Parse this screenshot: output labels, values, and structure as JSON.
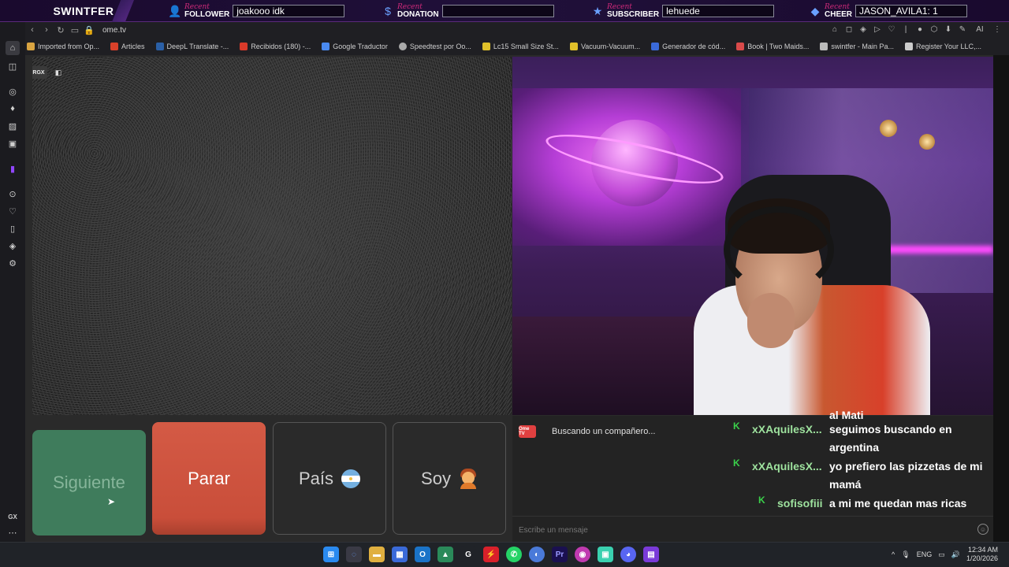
{
  "overlay": {
    "brand": "SWINTFER",
    "segments": [
      {
        "recent": "Recent",
        "kind": "FOLLOWER",
        "value": "joakooo idk",
        "icon": "user-icon"
      },
      {
        "recent": "Recent",
        "kind": "DONATION",
        "value": "",
        "icon": "dollar-icon"
      },
      {
        "recent": "Recent",
        "kind": "SUBSCRIBER",
        "value": "lehuede",
        "icon": "star-icon"
      },
      {
        "recent": "Recent",
        "kind": "CHEER",
        "value": "JASON_AVILA1: 1",
        "icon": "gem-icon"
      }
    ]
  },
  "browser": {
    "url": "ome.tv",
    "bookmarks": [
      {
        "label": "Imported from Op...",
        "color": "#d9a441"
      },
      {
        "label": "Articles",
        "color": "#d9412a"
      },
      {
        "label": "DeepL Translate -...",
        "color": "#2a5fa6"
      },
      {
        "label": "Recibidos (180) -...",
        "color": "#d93a2a"
      },
      {
        "label": "Google Traductor",
        "color": "#4a8af0"
      },
      {
        "label": "Speedtest por Oo...",
        "color": "#aaaaaa"
      },
      {
        "label": "Lc15 Small Size St...",
        "color": "#e0c02a"
      },
      {
        "label": "Vacuum-Vacuum...",
        "color": "#e0c02a"
      },
      {
        "label": "Generador de cód...",
        "color": "#3a6ad9"
      },
      {
        "label": "Book | Two Maids...",
        "color": "#d94a4a"
      },
      {
        "label": "swintfer - Main Pa...",
        "color": "#bbbbbb"
      },
      {
        "label": "Register Your LLC,...",
        "color": "#cccccc"
      }
    ],
    "ai_label": "AI"
  },
  "video": {
    "rgx_label": "RGX"
  },
  "buttons": {
    "next": "Siguiente",
    "stop": "Parar",
    "country": "País",
    "me": "Soy"
  },
  "chat": {
    "status": "Buscando un compañero...",
    "partial": "al Mati",
    "messages": [
      {
        "user": "xXAquilesX...",
        "text": "seguimos buscando en argentina"
      },
      {
        "user": "xXAquilesX...",
        "text": "yo prefiero las pizzetas de mi mamá"
      },
      {
        "user": "sofisofiii",
        "text": "a mi me quedan mas ricas"
      }
    ],
    "input_placeholder": "Escribe un mensaje",
    "ome_logo": "Ome TV"
  },
  "taskbar": {
    "lang": "ENG",
    "time": "12:34 AM",
    "date": "1/20/2026"
  },
  "colors": {
    "accent_green": "#3f7c5c",
    "accent_red": "#d45a45",
    "chat_username": "#9ee29e",
    "kick_green": "#3ad14a"
  }
}
